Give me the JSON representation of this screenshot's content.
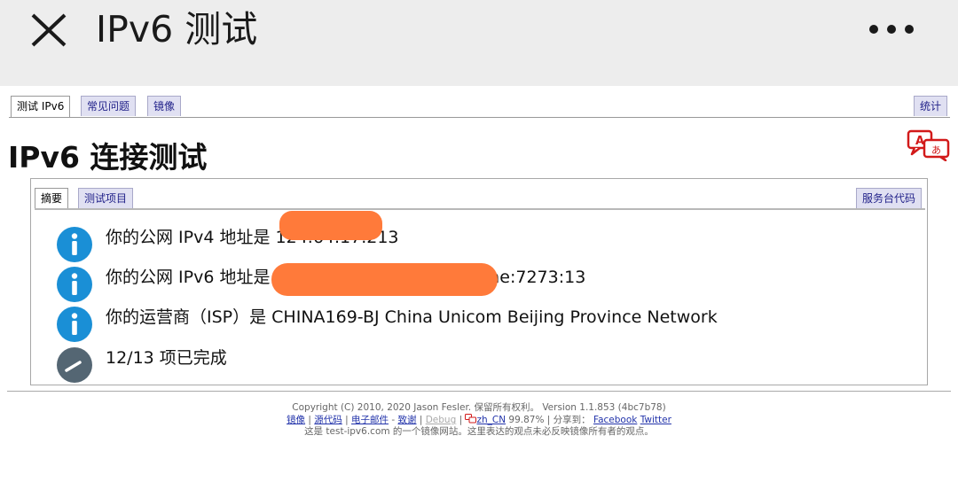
{
  "app_bar": {
    "title": "IPv6 测试"
  },
  "top_tabs": [
    {
      "label": "测试 IPv6",
      "active": true
    },
    {
      "label": "常见问题",
      "active": false
    },
    {
      "label": "镜像",
      "active": false
    }
  ],
  "stats_tab": {
    "label": "统计"
  },
  "page_title": "IPv6 连接测试",
  "inner_tabs": [
    {
      "label": "摘要",
      "active": true
    },
    {
      "label": "测试项目",
      "active": false
    }
  ],
  "service_code_tab": {
    "label": "服务台代码"
  },
  "results": [
    {
      "icon": "info-icon",
      "text": "你的公网 IPv4 地址是 124.64.17.213"
    },
    {
      "icon": "info-icon",
      "text": "你的公网 IPv6 地址是 2408:8207:1871:26c0:5aae:7273:13"
    },
    {
      "icon": "info-icon",
      "text": "你的运营商（ISP）是 CHINA169-BJ China Unicom Beijing Province Network"
    },
    {
      "icon": "progress-icon",
      "text": "12/13 项已完成"
    }
  ],
  "footer": {
    "copyright": "Copyright (C) 2010, 2020 Jason Fesler. 保留所有权利。 Version 1.1.853 (4bc7b78)",
    "links": {
      "mirror": "镜像",
      "source": "源代码",
      "email": "电子邮件",
      "email_value": " - ",
      "thanks": "致谢",
      "debug": "Debug",
      "locale": "zh_CN",
      "locale_pct": "99.87%",
      "share_label": "分享到：",
      "facebook": "Facebook",
      "twitter": "Twitter"
    },
    "note": "这是 test-ipv6.com 的一个镜像网站。这里表达的观点未必反映镜像所有者的观点。"
  },
  "colors": {
    "info_icon": "#1a8fd6",
    "progress_icon": "#546673",
    "redaction": "#ff7a3a",
    "tab_bg": "#e0e0f2",
    "tab_text": "#22228a"
  }
}
